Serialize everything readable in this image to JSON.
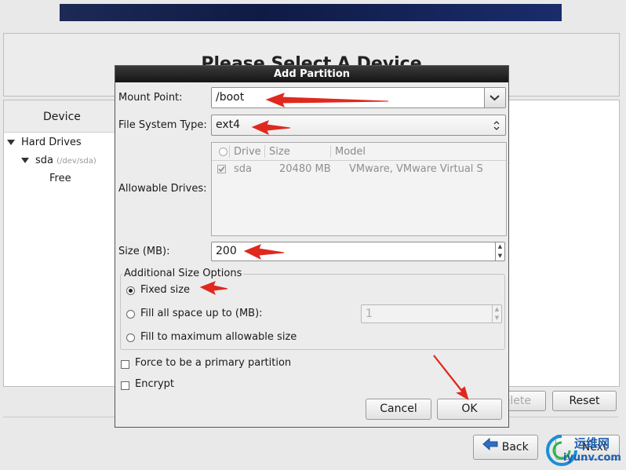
{
  "background": {
    "page_title": "Please Select A Device",
    "tree": {
      "column_header": "Device",
      "hard_drives": "Hard Drives",
      "sda_label": "sda",
      "sda_path": "(/dev/sda)",
      "free": "Free"
    },
    "buttons": {
      "delete": "Delete",
      "reset": "Reset",
      "back": "Back",
      "next": "Next"
    }
  },
  "dialog": {
    "title": "Add Partition",
    "mount_point": {
      "label": "Mount Point:",
      "value": "/boot"
    },
    "fs_type": {
      "label": "File System Type:",
      "value": "ext4"
    },
    "allowable_drives": {
      "label": "Allowable Drives:",
      "columns": [
        "Drive",
        "Size",
        "Model"
      ],
      "rows": [
        {
          "drive": "sda",
          "size": "20480 MB",
          "model": "VMware, VMware Virtual S",
          "checked": true
        }
      ]
    },
    "size": {
      "label": "Size (MB):",
      "value": "200"
    },
    "additional_options": {
      "legend": "Additional Size Options",
      "fixed": "Fixed size",
      "fill_up_to": "Fill all space up to (MB):",
      "fill_up_to_value": "1",
      "fill_max": "Fill to maximum allowable size",
      "selected": "fixed"
    },
    "force_primary": "Force to be a primary partition",
    "encrypt": "Encrypt",
    "cancel": "Cancel",
    "ok": "OK"
  },
  "watermark": {
    "cn": "运维网",
    "url": "iyunv.com"
  },
  "colors": {
    "annotation_arrow": "#e0281e",
    "dialog_titlebar": "#1e1e1e",
    "banner": "#1c2a55"
  }
}
